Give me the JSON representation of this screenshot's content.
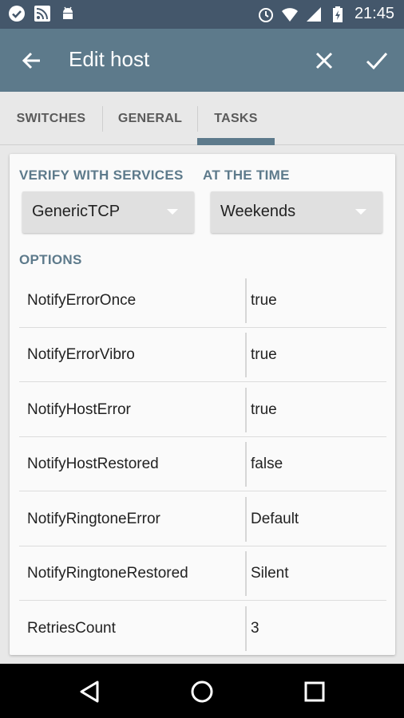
{
  "status_bar": {
    "time": "21:45",
    "icons_left": [
      "check-circle-icon",
      "rss-icon",
      "android-icon"
    ],
    "icons_right": [
      "alarm-icon",
      "wifi-icon",
      "signal-icon",
      "battery-charging-icon"
    ]
  },
  "toolbar": {
    "title": "Edit host",
    "background": "#5d7a8b"
  },
  "tabs": [
    {
      "label": "SWITCHES",
      "selected": false
    },
    {
      "label": "GENERAL",
      "selected": false
    },
    {
      "label": "TASKS",
      "selected": true
    }
  ],
  "form": {
    "verify_label": "VERIFY WITH SERVICES",
    "verify_value": "GenericTCP",
    "time_label": "AT THE TIME",
    "time_value": "Weekends",
    "options_label": "OPTIONS",
    "options": [
      {
        "name": "NotifyErrorOnce",
        "value": "true"
      },
      {
        "name": "NotifyErrorVibro",
        "value": "true"
      },
      {
        "name": "NotifyHostError",
        "value": "true"
      },
      {
        "name": "NotifyHostRestored",
        "value": "false"
      },
      {
        "name": "NotifyRingtoneError",
        "value": "Default"
      },
      {
        "name": "NotifyRingtoneRestored",
        "value": "Silent"
      },
      {
        "name": "RetriesCount",
        "value": "3"
      }
    ]
  },
  "nav_bar": {
    "icons": [
      "back-triangle-icon",
      "home-circle-icon",
      "recents-square-icon"
    ]
  },
  "colors": {
    "accent": "#5d7a8b",
    "status_bar": "#44576b"
  }
}
